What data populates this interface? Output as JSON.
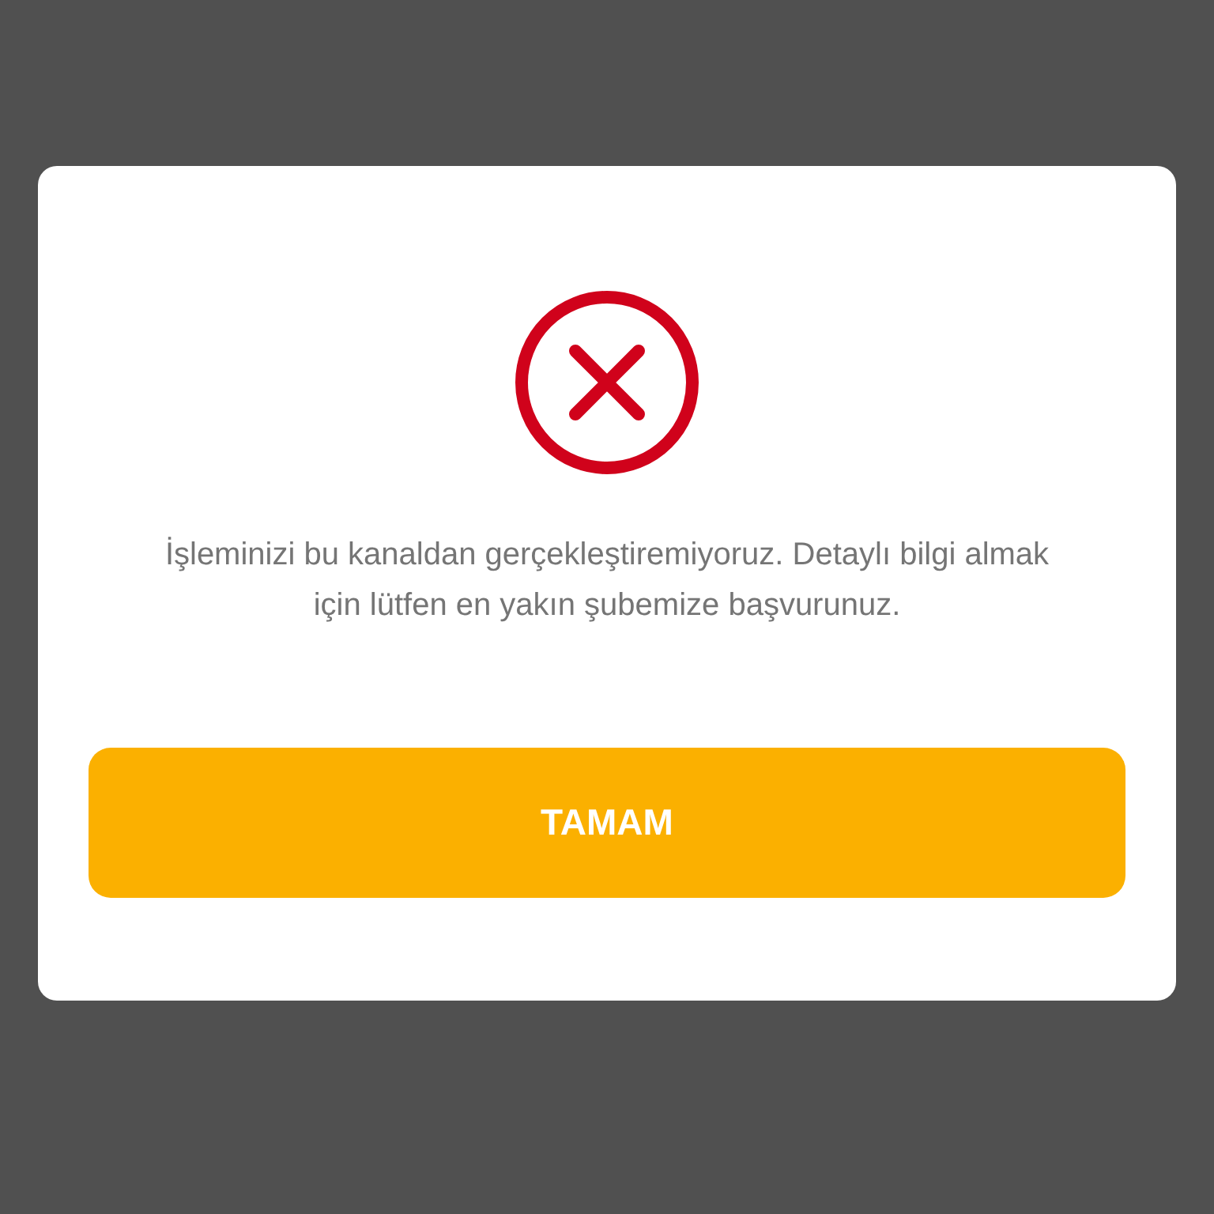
{
  "dialog": {
    "message": "İşleminizi bu kanaldan gerçekleştiremiyoruz. Detaylı bilgi almak için lütfen en yakın şubemize başvurunuz.",
    "button": {
      "label": "TAMAM"
    }
  }
}
